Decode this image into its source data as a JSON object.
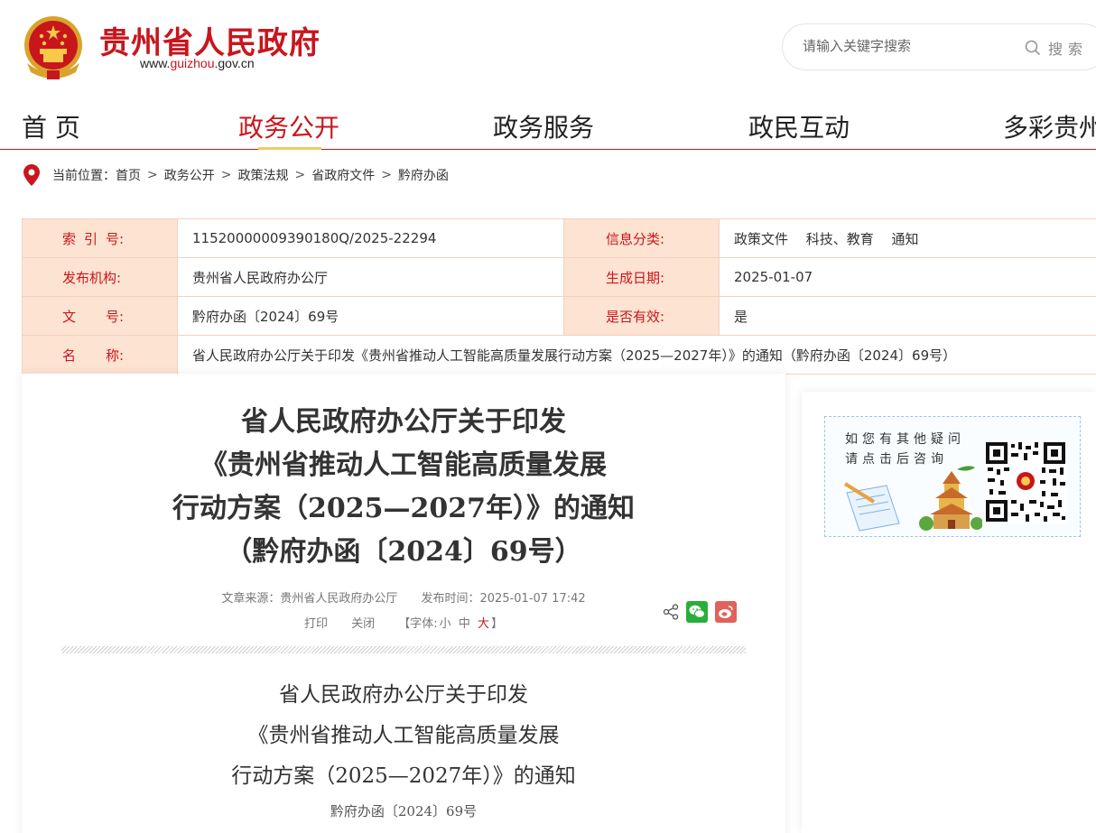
{
  "header": {
    "site_title": "贵州省人民政府",
    "site_url_prefix": "www.",
    "site_url_highlight": "guizhou",
    "site_url_suffix": ".gov.cn",
    "search_placeholder": "请输入关键字搜索",
    "search_label": "搜索"
  },
  "nav": {
    "items": [
      {
        "label": "首 页"
      },
      {
        "label": "政务公开",
        "active": true
      },
      {
        "label": "政务服务"
      },
      {
        "label": "政民互动"
      },
      {
        "label": "多彩贵州"
      }
    ]
  },
  "breadcrumb": {
    "prefix": "当前位置：",
    "items": [
      "首页",
      "政务公开",
      "政策法规",
      "省政府文件",
      "黔府办函"
    ],
    "separator": ">"
  },
  "info": {
    "index_key": [
      "索",
      "引",
      "号:"
    ],
    "index_value": "11520000009390180Q/2025-22294",
    "category_key": "信息分类:",
    "category_value": "政策文件　 科技、教育　 通知",
    "publisher_key": "发布机构:",
    "publisher_value": "贵州省人民政府办公厅",
    "date_key": "生成日期:",
    "date_value": "2025-01-07",
    "docno_key": [
      "文",
      "号:"
    ],
    "docno_value": "黔府办函〔2024〕69号",
    "valid_key": "是否有效:",
    "valid_value": "是",
    "name_key": [
      "名",
      "称:"
    ],
    "name_value": "省人民政府办公厅关于印发《贵州省推动人工智能高质量发展行动方案（2025—2027年）》的通知（黔府办函〔2024〕69号）"
  },
  "article": {
    "title_lines": [
      "省人民政府办公厅关于印发",
      "《贵州省推动人工智能高质量发展",
      "行动方案（2025—2027年）》的通知",
      "（黔府办函〔2024〕69号）"
    ],
    "source": "文章来源：贵州省人民政府办公厅",
    "publish_time": "发布时间：2025-01-07 17:42",
    "print_label": "打印",
    "close_label": "关闭",
    "font_size_prefix": "【字体:",
    "font_small": "小",
    "font_medium": "中",
    "font_large": "大",
    "font_size_suffix": "】",
    "body_title_lines": [
      "省人民政府办公厅关于印发",
      "《贵州省推动人工智能高质量发展",
      "行动方案（2025—2027年）》的通知"
    ],
    "doc_number": "黔府办函〔2024〕69号"
  },
  "sidebar": {
    "consult_line1": "如您有其他疑问",
    "consult_line2": "请点击后咨询"
  },
  "colors": {
    "brand_red": "#c8161d",
    "info_key_bg": "#fde3d1",
    "wechat_green": "#2aae3b",
    "weibo_red": "#e0625a"
  },
  "icons": [
    "national-emblem-icon",
    "search-icon",
    "location-pin-icon",
    "share-icon",
    "wechat-icon",
    "weibo-icon",
    "qr-code-icon"
  ]
}
